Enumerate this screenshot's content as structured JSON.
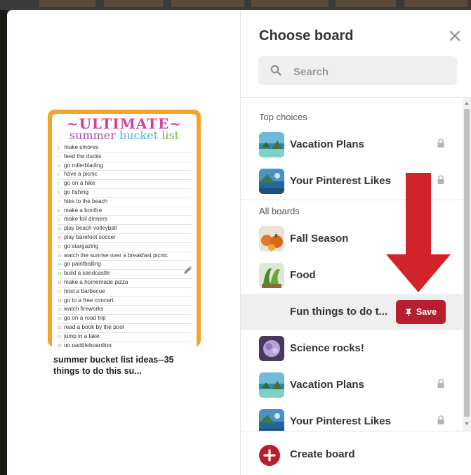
{
  "background_tabs": [
    "",
    "",
    "",
    "",
    "",
    ""
  ],
  "pin": {
    "title_line1": "~ULTIMATE~",
    "title_summer": "summer",
    "title_bucket": "bucket",
    "title_list": "list",
    "items": [
      {
        "n": "1",
        "t": "make smores"
      },
      {
        "n": "2",
        "t": "feed the ducks"
      },
      {
        "n": "3",
        "t": "go rollerblading"
      },
      {
        "n": "4",
        "t": "have a picnic"
      },
      {
        "n": "5",
        "t": "go on a hike"
      },
      {
        "n": "6",
        "t": "go fishing"
      },
      {
        "n": "7",
        "t": "hike to the beach"
      },
      {
        "n": "8",
        "t": "make a bonfire"
      },
      {
        "n": "9",
        "t": "make foil dinners"
      },
      {
        "n": "10",
        "t": "play beach volleyball"
      },
      {
        "n": "11",
        "t": "play barefoot soccer"
      },
      {
        "n": "12",
        "t": "go stargazing"
      },
      {
        "n": "13",
        "t": "watch the sunrise over a breakfast picnic"
      },
      {
        "n": "14",
        "t": "go paintballing"
      },
      {
        "n": "15",
        "t": "build a sandcastle"
      },
      {
        "n": "16",
        "t": "make a homemade pizza"
      },
      {
        "n": "17",
        "t": "host a barbecue"
      },
      {
        "n": "18",
        "t": "go to a free concert"
      },
      {
        "n": "19",
        "t": "watch fireworks"
      },
      {
        "n": "20",
        "t": "go on a road trip"
      },
      {
        "n": "21",
        "t": "read a book by the pool"
      },
      {
        "n": "22",
        "t": "jump in a lake"
      },
      {
        "n": "23",
        "t": "go paddleboarding"
      }
    ],
    "caption": "summer bucket list ideas--35 things to do this su...",
    "edit_icon": "pencil-icon"
  },
  "panel": {
    "title": "Choose board",
    "close_icon": "close-icon",
    "search": {
      "placeholder": "Search",
      "value": "",
      "icon": "search-icon"
    },
    "top_choices_label": "Top choices",
    "all_boards_label": "All boards",
    "top_choices": [
      {
        "name": "Vacation Plans",
        "secret": true,
        "thumb": "vacation"
      },
      {
        "name": "Your Pinterest Likes",
        "secret": true,
        "thumb": "likes"
      }
    ],
    "all_boards": [
      {
        "name": "Fall Season",
        "secret": false,
        "thumb": "fall"
      },
      {
        "name": "Food",
        "secret": false,
        "thumb": "food"
      },
      {
        "name": "Fun things to do t...",
        "secret": false,
        "thumb": "none",
        "hovered": true
      },
      {
        "name": "Science rocks!",
        "secret": false,
        "thumb": "science"
      },
      {
        "name": "Vacation Plans",
        "secret": true,
        "thumb": "vacation"
      },
      {
        "name": "Your Pinterest Likes",
        "secret": true,
        "thumb": "likes"
      }
    ],
    "save_label": "Save",
    "save_icon": "pin-icon",
    "create_label": "Create board",
    "create_icon": "plus-icon"
  },
  "colors": {
    "save_button": "#b81f2e",
    "annotation_arrow": "#d2232a",
    "pin_border": "#f3a52a"
  }
}
